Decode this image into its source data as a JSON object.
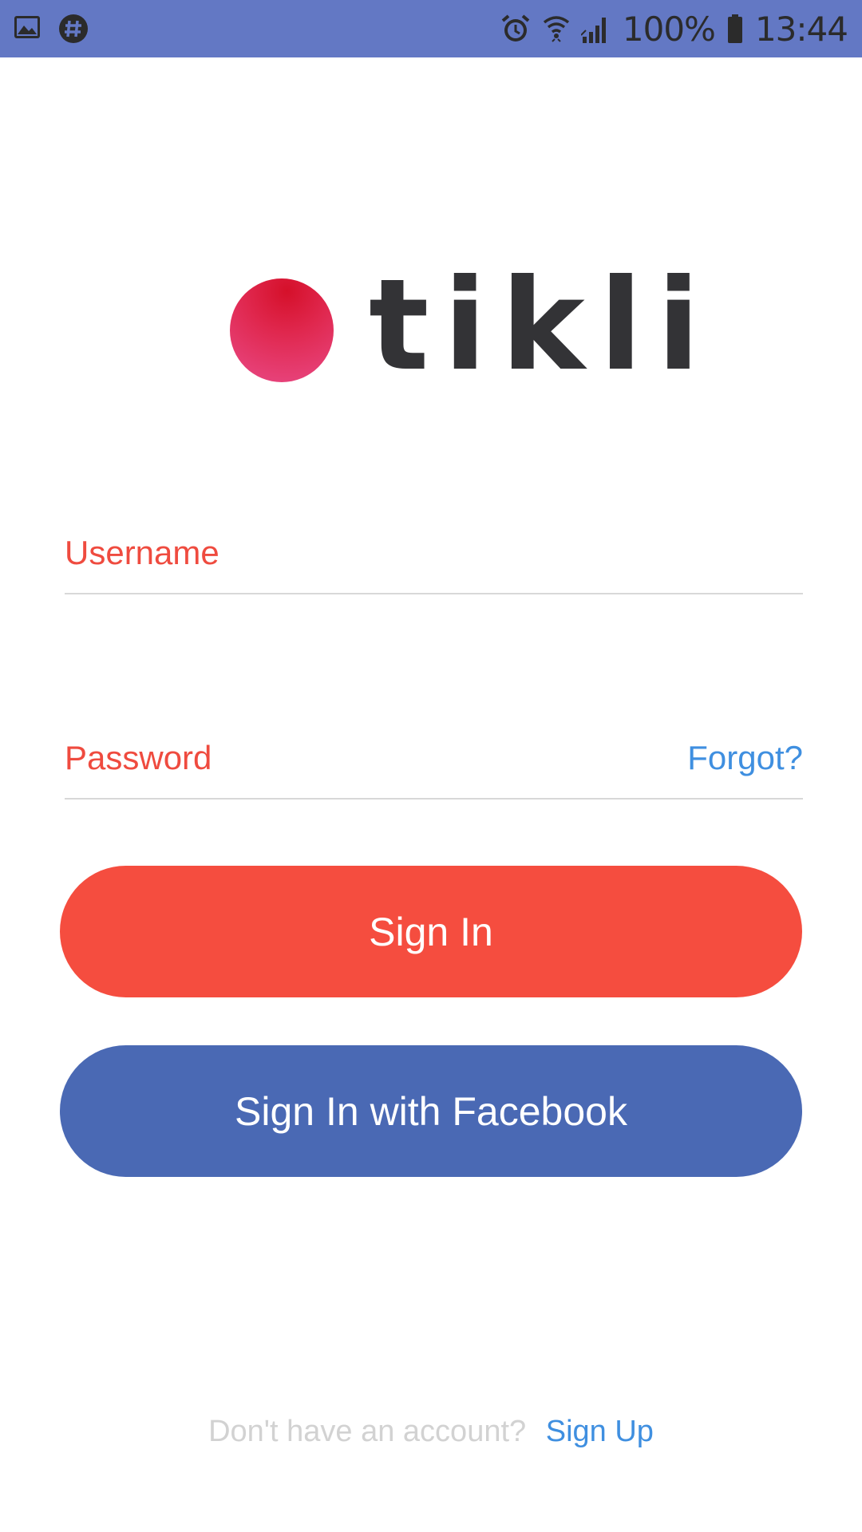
{
  "status_bar": {
    "battery": "100%",
    "time": "13:44",
    "left_icons": [
      "image-icon",
      "slack-icon"
    ],
    "right_icons": [
      "alarm-icon",
      "wifi-icon",
      "signal-icon",
      "battery-icon"
    ]
  },
  "logo": {
    "text": "tikli",
    "dot_color": "#e0284f"
  },
  "form": {
    "username_label": "Username",
    "password_label": "Password",
    "forgot_link": "Forgot?",
    "signin_button": "Sign In",
    "facebook_button": "Sign In with Facebook"
  },
  "footer": {
    "prompt": "Don't have an account?",
    "signup_link": "Sign Up"
  },
  "colors": {
    "status_bar": "#6378c4",
    "accent_red": "#f54d3f",
    "facebook_blue": "#4a69b4",
    "link_blue": "#3f8fe0",
    "label_red": "#ef4b3f"
  }
}
